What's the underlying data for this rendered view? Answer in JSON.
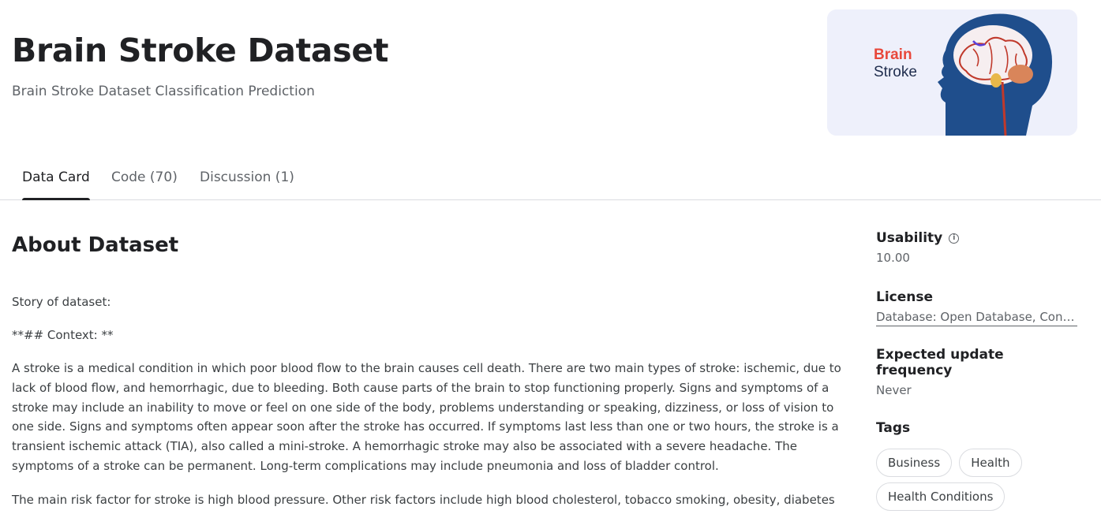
{
  "header": {
    "title": "Brain Stroke Dataset",
    "subtitle": "Brain Stroke Dataset Classification Prediction",
    "image": {
      "line1": "Brain",
      "line2": "Stroke",
      "accent": "#e8483b",
      "head_color": "#1f4e8c"
    }
  },
  "tabs": [
    {
      "label": "Data Card",
      "active": true
    },
    {
      "label": "Code (70)",
      "active": false
    },
    {
      "label": "Discussion (1)",
      "active": false
    }
  ],
  "main": {
    "heading": "About Dataset",
    "paragraphs": [
      "Story of dataset:",
      "**## Context: **",
      "A stroke is a medical condition in which poor blood flow to the brain causes cell death. There are two main types of stroke: ischemic, due to lack of blood flow, and hemorrhagic, due to bleeding. Both cause parts of the brain to stop functioning properly. Signs and symptoms of a stroke may include an inability to move or feel on one side of the body, problems understanding or speaking, dizziness, or loss of vision to one side. Signs and symptoms often appear soon after the stroke has occurred. If symptoms last less than one or two hours, the stroke is a transient ischemic attack (TIA), also called a mini-stroke. A hemorrhagic stroke may also be associated with a severe headache. The symptoms of a stroke can be permanent. Long-term complications may include pneumonia and loss of bladder control.",
      "The main risk factor for stroke is high blood pressure. Other risk factors include high blood cholesterol, tobacco smoking, obesity, diabetes"
    ]
  },
  "sidebar": {
    "usability": {
      "label": "Usability",
      "value": "10.00"
    },
    "license": {
      "label": "License",
      "value": "Database: Open Database, Contents: Database Contents"
    },
    "update": {
      "label": "Expected update frequency",
      "value": "Never"
    },
    "tags": {
      "label": "Tags",
      "items": [
        "Business",
        "Health",
        "Health Conditions"
      ]
    }
  }
}
